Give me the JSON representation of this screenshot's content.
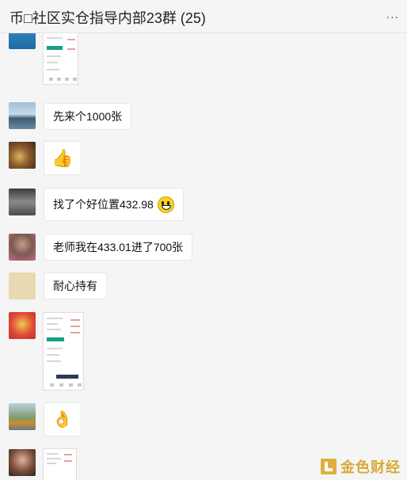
{
  "header": {
    "title": "币□社区实仓指导内部23群 (25)",
    "more_label": "..."
  },
  "messages": [
    {
      "type": "image",
      "content": "trade-screenshot"
    },
    {
      "type": "text",
      "text": "先来个1000张"
    },
    {
      "type": "emoji",
      "emoji": "👍"
    },
    {
      "type": "text",
      "text": "找了个好位置432.98",
      "emoji": "smiling-face-icon"
    },
    {
      "type": "text",
      "text": "老师我在433.01进了700张"
    },
    {
      "type": "text",
      "text": "耐心持有"
    },
    {
      "type": "image",
      "content": "trade-screenshot"
    },
    {
      "type": "emoji",
      "emoji": "👌"
    },
    {
      "type": "image",
      "content": "trade-screenshot"
    }
  ],
  "watermark": {
    "text": "金色财经"
  }
}
